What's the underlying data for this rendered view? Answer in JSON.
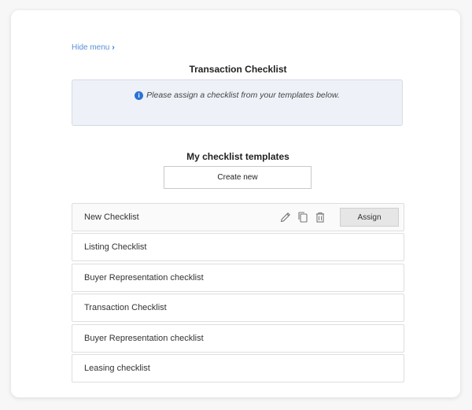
{
  "menu": {
    "hide_label": "Hide menu",
    "chevron": "›"
  },
  "header": {
    "title": "Transaction Checklist"
  },
  "notice": {
    "icon": "info-icon",
    "text": "Please assign a checklist from your templates below."
  },
  "templates": {
    "section_title": "My checklist templates",
    "create_label": "Create new",
    "assign_label": "Assign",
    "items": [
      {
        "label": "New Checklist"
      },
      {
        "label": "Listing Checklist"
      },
      {
        "label": "Buyer Representation checklist"
      },
      {
        "label": "Transaction Checklist"
      },
      {
        "label": "Buyer Representation checklist"
      },
      {
        "label": "Leasing checklist"
      }
    ]
  },
  "colors": {
    "accent": "#2b73d6",
    "link": "#5a8fd8",
    "notice_bg": "#eef2f8"
  }
}
